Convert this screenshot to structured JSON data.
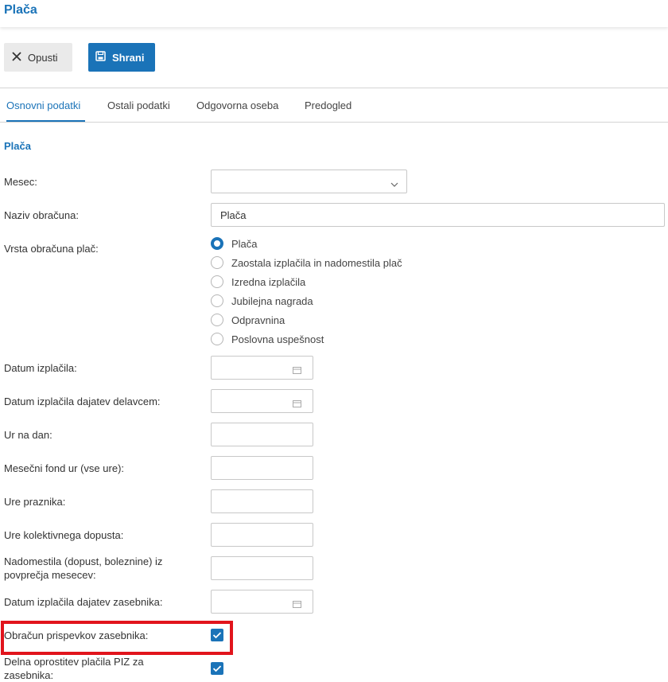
{
  "header": {
    "title": "Plača"
  },
  "toolbar": {
    "cancel_label": "Opusti",
    "save_label": "Shrani"
  },
  "tabs": [
    {
      "label": "Osnovni podatki",
      "active": true
    },
    {
      "label": "Ostali podatki",
      "active": false
    },
    {
      "label": "Odgovorna oseba",
      "active": false
    },
    {
      "label": "Predogled",
      "active": false
    }
  ],
  "section": {
    "title": "Plača"
  },
  "form": {
    "month": {
      "label": "Mesec:",
      "value": ""
    },
    "calc_name": {
      "label": "Naziv obračuna:",
      "value": "Plača"
    },
    "calc_type": {
      "label": "Vrsta obračuna plač:",
      "options": [
        "Plača",
        "Zaostala izplačila in nadomestila plač",
        "Izredna izplačila",
        "Jubilejna nagrada",
        "Odpravnina",
        "Poslovna uspešnost"
      ],
      "selected": "Plača"
    },
    "payout_date": {
      "label": "Datum izplačila:",
      "value": ""
    },
    "payout_levies_employee": {
      "label": "Datum izplačila dajatev delavcem:",
      "value": ""
    },
    "hours_per_day": {
      "label": "Ur na dan:",
      "value": ""
    },
    "monthly_hours": {
      "label": "Mesečni fond ur (vse ure):",
      "value": ""
    },
    "holiday_hours": {
      "label": "Ure praznika:",
      "value": ""
    },
    "collective_leave_hours": {
      "label": "Ure kolektivnega dopusta:",
      "value": ""
    },
    "compensation_months": {
      "label_line1": "Nadomestila (dopust, boleznine) iz",
      "label_line2": "povprečja mesecev:",
      "value": ""
    },
    "payout_levies_entrepreneur": {
      "label": "Datum izplačila dajatev zasebnika:",
      "value": ""
    },
    "entrepreneur_contributions": {
      "label": "Obračun prispevkov zasebnika:",
      "checked": true
    },
    "piz_exemption": {
      "label_line1": "Delna oprostitev plačila PIZ za",
      "label_line2": "zasebnika:",
      "checked": true
    }
  },
  "colors": {
    "accent": "#1a73b8",
    "highlight": "#e1141c"
  }
}
